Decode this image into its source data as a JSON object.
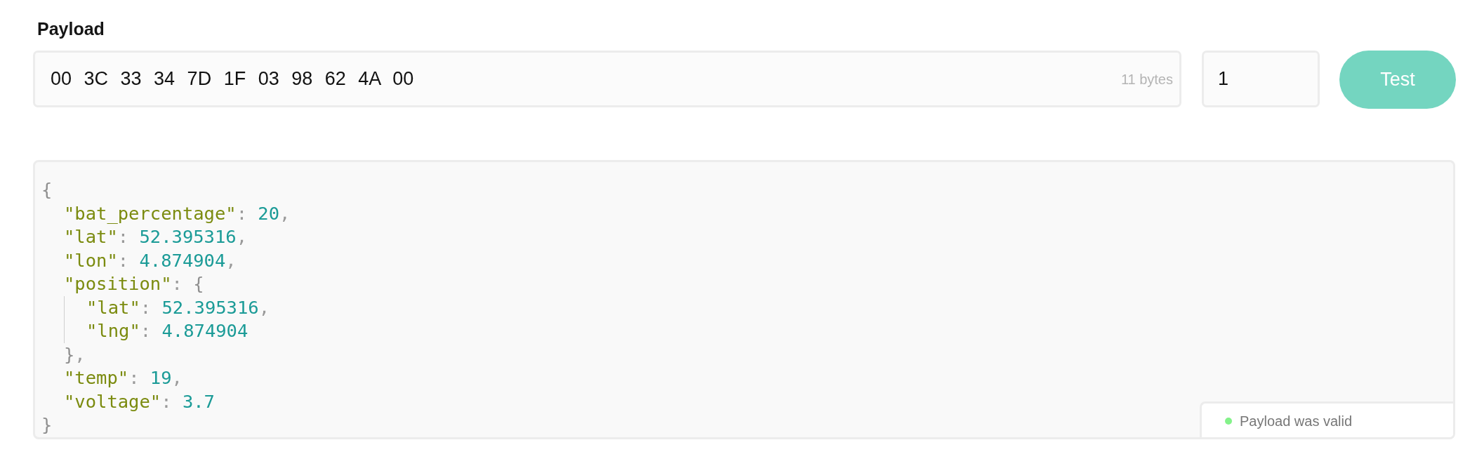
{
  "title": "Payload",
  "payload_field": {
    "value": "00 3C 33 34 7D 1F 03 98 62 4A 00",
    "byte_count": "11 bytes"
  },
  "port_field": {
    "value": "1"
  },
  "test_button": {
    "label": "Test"
  },
  "output": {
    "lines": [
      {
        "tokens": [
          {
            "kind": "brace",
            "text": "{"
          }
        ],
        "children": [
          {
            "tokens": [
              {
                "kind": "key",
                "text": "\"bat_percentage\""
              },
              {
                "kind": "colon",
                "text": ":"
              },
              {
                "kind": "number",
                "text": "20"
              },
              {
                "kind": "comma",
                "text": ","
              }
            ]
          },
          {
            "tokens": [
              {
                "kind": "key",
                "text": "\"lat\""
              },
              {
                "kind": "colon",
                "text": ":"
              },
              {
                "kind": "number",
                "text": "52.395316"
              },
              {
                "kind": "comma",
                "text": ","
              }
            ]
          },
          {
            "tokens": [
              {
                "kind": "key",
                "text": "\"lon\""
              },
              {
                "kind": "colon",
                "text": ":"
              },
              {
                "kind": "number",
                "text": "4.874904"
              },
              {
                "kind": "comma",
                "text": ","
              }
            ]
          },
          {
            "tokens": [
              {
                "kind": "key",
                "text": "\"position\""
              },
              {
                "kind": "colon",
                "text": ":"
              },
              {
                "kind": "brace",
                "text": "{"
              }
            ],
            "children": [
              {
                "tokens": [
                  {
                    "kind": "key",
                    "text": "\"lat\""
                  },
                  {
                    "kind": "colon",
                    "text": ":"
                  },
                  {
                    "kind": "number",
                    "text": "52.395316"
                  },
                  {
                    "kind": "comma",
                    "text": ","
                  }
                ]
              },
              {
                "tokens": [
                  {
                    "kind": "key",
                    "text": "\"lng\""
                  },
                  {
                    "kind": "colon",
                    "text": ":"
                  },
                  {
                    "kind": "number",
                    "text": "4.874904"
                  }
                ]
              }
            ]
          },
          {
            "tokens": [
              {
                "kind": "brace",
                "text": "}"
              },
              {
                "kind": "comma",
                "text": ","
              }
            ]
          },
          {
            "tokens": [
              {
                "kind": "key",
                "text": "\"temp\""
              },
              {
                "kind": "colon",
                "text": ":"
              },
              {
                "kind": "number",
                "text": "19"
              },
              {
                "kind": "comma",
                "text": ","
              }
            ]
          },
          {
            "tokens": [
              {
                "kind": "key",
                "text": "\"voltage\""
              },
              {
                "kind": "colon",
                "text": ":"
              },
              {
                "kind": "number",
                "text": "3.7"
              }
            ]
          }
        ]
      },
      {
        "tokens": [
          {
            "kind": "brace",
            "text": "}"
          }
        ]
      }
    ]
  },
  "status": {
    "valid": true,
    "message": "Payload was valid"
  }
}
